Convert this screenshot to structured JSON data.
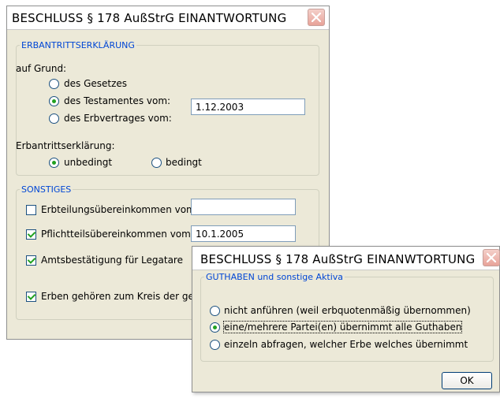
{
  "main_dialog": {
    "title": "BESCHLUSS § 178 AußStrG EINANTWORTUNG",
    "group_erbantritt": {
      "legend": "ERBANTRITTSERKLÄRUNG",
      "auf_grund_label": "auf Grund:",
      "options": [
        {
          "label": "des Gesetzes",
          "selected": false
        },
        {
          "label": "des Testamentes vom:",
          "selected": true
        },
        {
          "label": "des Erbvertrages vom:",
          "selected": false
        }
      ],
      "date_value": "1.12.2003",
      "erklaerung_label": "Erbantrittserklärung:",
      "type_options": [
        {
          "label": "unbedingt",
          "selected": true
        },
        {
          "label": "bedingt",
          "selected": false
        }
      ]
    },
    "group_sonstiges": {
      "legend": "SONSTIGES",
      "items": [
        {
          "label": "Erbteilungsübereinkommen vom:",
          "checked": false,
          "value": ""
        },
        {
          "label": "Pflichtteilsübereinkommen vom:",
          "checked": true,
          "value": "10.1.2005"
        },
        {
          "label": "Amtsbestätigung für Legatare",
          "checked": true
        },
        {
          "label": "Erben gehören zum Kreis der gese",
          "checked": true
        }
      ]
    }
  },
  "popup_dialog": {
    "title": "BESCHLUSS § 178 AußStrG EINANWTORTUNG",
    "group": {
      "legend": "GUTHABEN und sonstige Aktiva",
      "options": [
        {
          "label": "nicht anführen (weil erbquotenmäßig übernommen)",
          "selected": false
        },
        {
          "label": "eine/mehrere Partei(en) übernimmt alle Guthaben",
          "selected": true
        },
        {
          "label": "einzeln abfragen, welcher Erbe welches übernimmt",
          "selected": false
        }
      ]
    },
    "ok_label": "OK"
  },
  "colors": {
    "legend": "#0046d5",
    "dialog_bg": "#ece9d8",
    "check_green": "#21a121"
  }
}
